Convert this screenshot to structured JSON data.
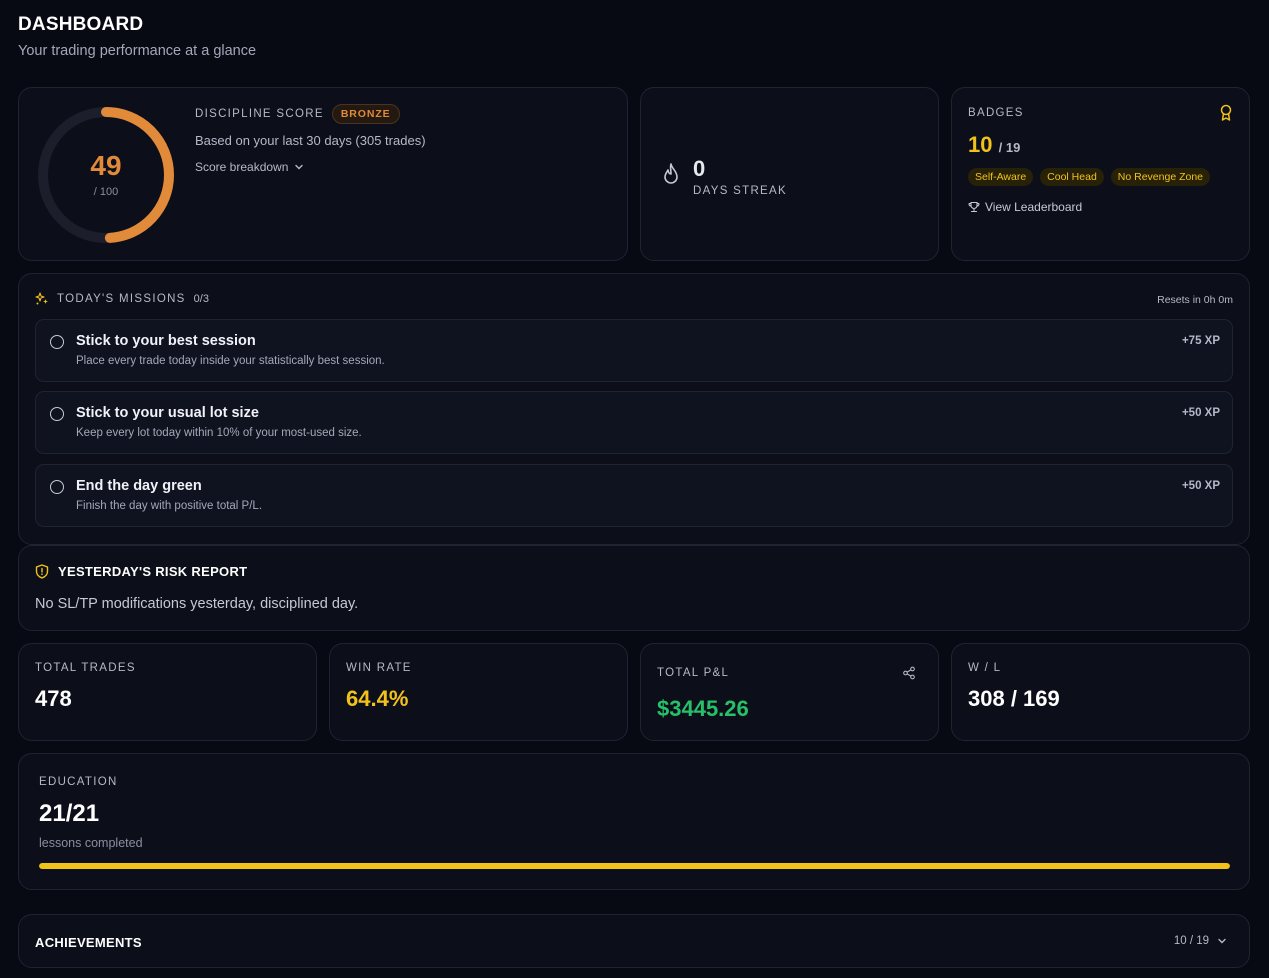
{
  "header": {
    "title": "DASHBOARD",
    "subtitle": "Your trading performance at a glance"
  },
  "discipline": {
    "score": "49",
    "max_label": "/ 100",
    "score_fraction": 0.49,
    "title": "DISCIPLINE SCORE",
    "tier": "BRONZE",
    "description": "Based on your last 30 days (305 trades)",
    "breakdown_label": "Score breakdown",
    "gauge_color": "#e08a3a"
  },
  "streak": {
    "value": "0",
    "label": "DAYS STREAK",
    "icon": "flame-icon"
  },
  "badges": {
    "title": "BADGES",
    "earned": "10",
    "total": "/ 19",
    "items": [
      "Self-Aware",
      "Cool Head",
      "No Revenge Zone"
    ],
    "leaderboard_label": "View Leaderboard",
    "accent": "#f2c21b"
  },
  "missions": {
    "title": "TODAY'S MISSIONS",
    "count": "0/3",
    "resets": "Resets in 0h 0m",
    "items": [
      {
        "title": "Stick to your best session",
        "description": "Place every trade today inside your statistically best session.",
        "xp": "+75 XP"
      },
      {
        "title": "Stick to your usual lot size",
        "description": "Keep every lot today within 10% of your most-used size.",
        "xp": "+50 XP"
      },
      {
        "title": "End the day green",
        "description": "Finish the day with positive total P/L.",
        "xp": "+50 XP"
      }
    ]
  },
  "risk_report": {
    "title": "YESTERDAY'S RISK REPORT",
    "text": "No SL/TP modifications yesterday, disciplined day."
  },
  "stats": {
    "total_trades": {
      "label": "TOTAL TRADES",
      "value": "478"
    },
    "win_rate": {
      "label": "WIN RATE",
      "value": "64.4%",
      "color": "#f2c21b"
    },
    "total_pnl": {
      "label": "TOTAL P&L",
      "value": "$3445.26",
      "color": "#27c06a"
    },
    "win_loss": {
      "label": "W / L",
      "value": "308 / 169"
    }
  },
  "education": {
    "label": "EDUCATION",
    "value": "21/21",
    "sub": "lessons completed",
    "progress_fraction": 1.0
  },
  "achievements": {
    "title": "ACHIEVEMENTS",
    "count": "10 / 19"
  }
}
